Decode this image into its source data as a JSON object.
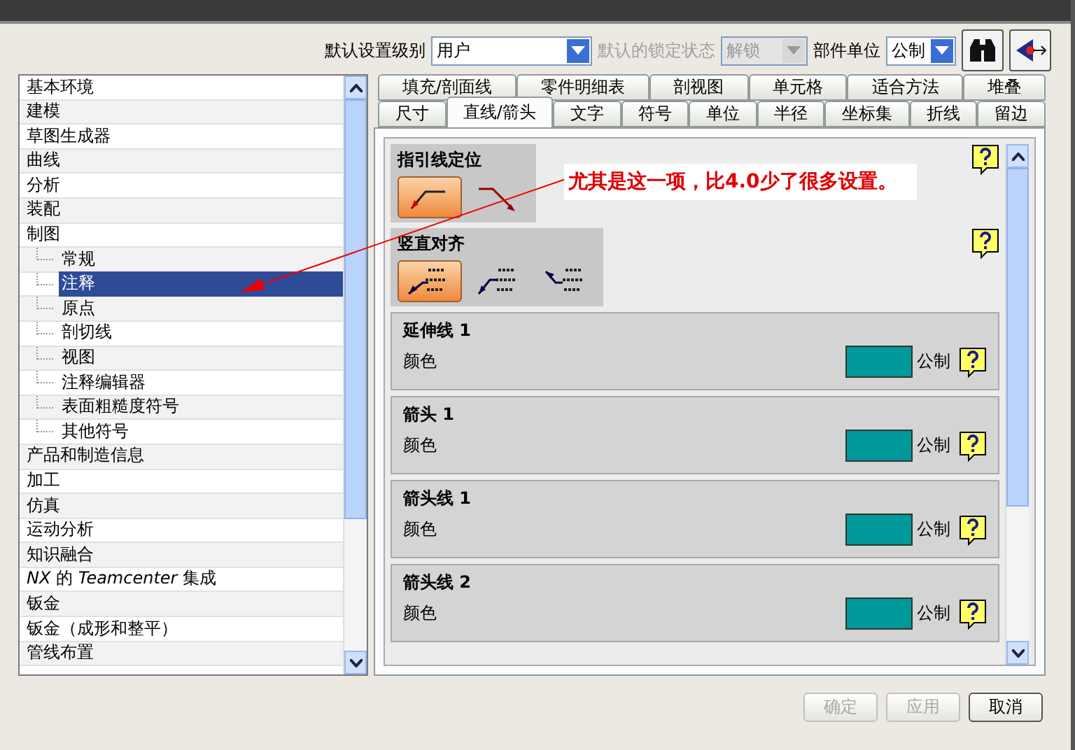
{
  "toolbar": {
    "level_label": "默认设置级别",
    "level_value": "用户",
    "lock_label": "默认的锁定状态",
    "lock_value": "解锁",
    "lock_disabled": true,
    "units_label": "部件单位",
    "units_value": "公制"
  },
  "tree": [
    {
      "label": "基本环境",
      "selected": false
    },
    {
      "label": "建模",
      "selected": false
    },
    {
      "label": "草图生成器",
      "selected": false
    },
    {
      "label": "曲线",
      "selected": false
    },
    {
      "label": "分析",
      "selected": false
    },
    {
      "label": "装配",
      "selected": false
    },
    {
      "label": "制图",
      "selected": false,
      "children": [
        {
          "label": "常规",
          "selected": false
        },
        {
          "label": "注释",
          "selected": true
        },
        {
          "label": "原点",
          "selected": false
        },
        {
          "label": "剖切线",
          "selected": false
        },
        {
          "label": "视图",
          "selected": false
        },
        {
          "label": "注释编辑器",
          "selected": false
        },
        {
          "label": "表面粗糙度符号",
          "selected": false
        },
        {
          "label": "其他符号",
          "selected": false
        }
      ]
    },
    {
      "label": "产品和制造信息",
      "selected": false
    },
    {
      "label": "加工",
      "selected": false
    },
    {
      "label": "仿真",
      "selected": false
    },
    {
      "label": "运动分析",
      "selected": false
    },
    {
      "label": "知识融合",
      "selected": false
    },
    {
      "label": "*NX* 的 *Teamcenter* 集成",
      "selected": false
    },
    {
      "label": "钣金",
      "selected": false
    },
    {
      "label": "钣金（成形和整平）",
      "selected": false
    },
    {
      "label": "管线布置",
      "selected": false
    }
  ],
  "tabs_back": [
    {
      "label": "填充/剖面线",
      "selected": false
    },
    {
      "label": "零件明细表",
      "selected": false
    },
    {
      "label": "剖视图",
      "selected": false
    },
    {
      "label": "单元格",
      "selected": false
    },
    {
      "label": "适合方法",
      "selected": false
    },
    {
      "label": "堆叠",
      "selected": false
    }
  ],
  "tabs_front": [
    {
      "label": "尺寸",
      "selected": false
    },
    {
      "label": "直线/箭头",
      "selected": true
    },
    {
      "label": "文字",
      "selected": false
    },
    {
      "label": "符号",
      "selected": false
    },
    {
      "label": "单位",
      "selected": false
    },
    {
      "label": "半径",
      "selected": false
    },
    {
      "label": "坐标集",
      "selected": false
    },
    {
      "label": "折线",
      "selected": false
    },
    {
      "label": "留边",
      "selected": false
    }
  ],
  "groups": [
    {
      "title": "指引线定位",
      "options": [
        {
          "kind": "leader-up",
          "selected": true
        },
        {
          "kind": "leader-down",
          "selected": false
        }
      ]
    },
    {
      "title": "竖直对齐",
      "options": [
        {
          "kind": "align-low",
          "selected": true
        },
        {
          "kind": "align-mid",
          "selected": false
        },
        {
          "kind": "align-high",
          "selected": false
        }
      ]
    }
  ],
  "sections": [
    {
      "title": "延伸线 1",
      "label": "颜色",
      "color": "#009999",
      "unit": "公制"
    },
    {
      "title": "箭头 1",
      "label": "颜色",
      "color": "#009999",
      "unit": "公制"
    },
    {
      "title": "箭头线 1",
      "label": "颜色",
      "color": "#009999",
      "unit": "公制"
    },
    {
      "title": "箭头线 2",
      "label": "颜色",
      "color": "#009999",
      "unit": "公制"
    }
  ],
  "annotation": {
    "text": "尤其是这一项，比4.0少了很多设置。"
  },
  "buttons": [
    {
      "label": "确定",
      "disabled": true
    },
    {
      "label": "应用",
      "disabled": true
    },
    {
      "label": "取消",
      "disabled": false
    }
  ]
}
